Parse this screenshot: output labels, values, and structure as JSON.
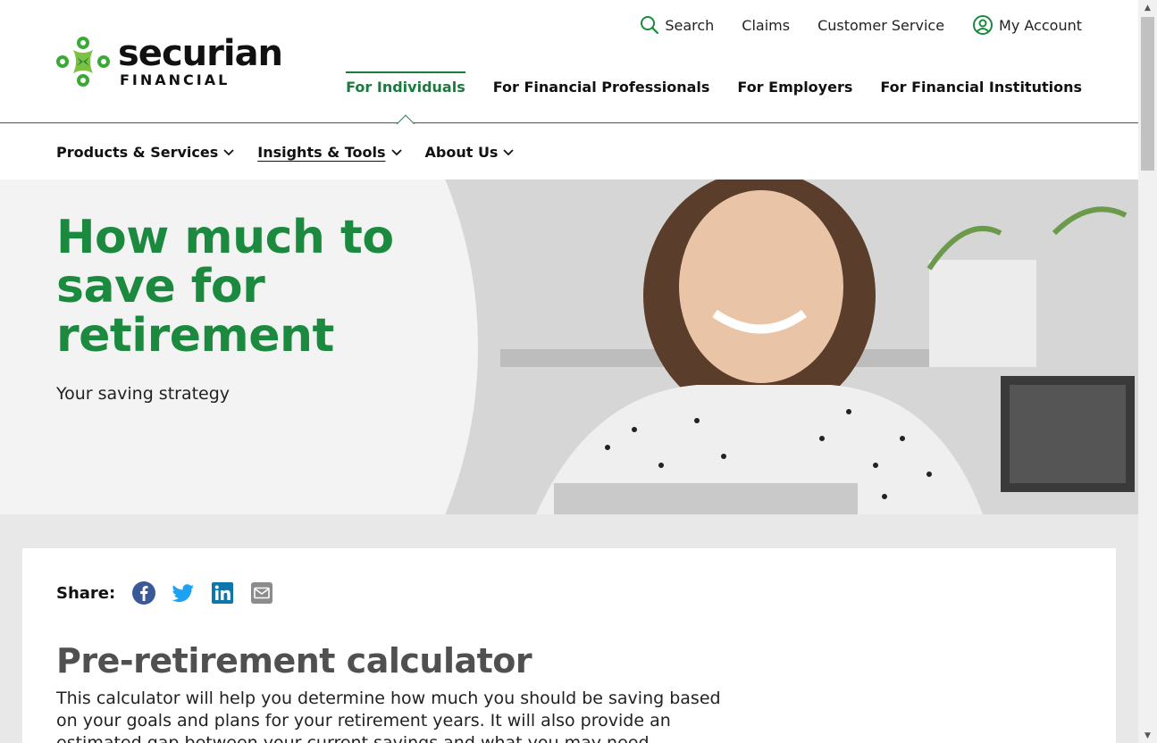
{
  "brand": {
    "name": "securian",
    "sub": "FINANCIAL",
    "green": "#1b8a3f"
  },
  "utility_nav": {
    "search": "Search",
    "claims": "Claims",
    "customer_service": "Customer Service",
    "my_account": "My Account"
  },
  "audience_nav": [
    {
      "label": "For Individuals",
      "active": true
    },
    {
      "label": "For Financial Professionals",
      "active": false
    },
    {
      "label": "For Employers",
      "active": false
    },
    {
      "label": "For Financial Institutions",
      "active": false
    }
  ],
  "sub_nav": [
    {
      "label": "Products & Services"
    },
    {
      "label": "Insights & Tools",
      "current": true
    },
    {
      "label": "About Us"
    }
  ],
  "hero": {
    "title": "How much to save for retirement",
    "subtitle": "Your saving strategy"
  },
  "share": {
    "label": "Share:",
    "icons": [
      "facebook-icon",
      "twitter-icon",
      "linkedin-icon",
      "email-icon"
    ]
  },
  "content": {
    "title": "Pre-retirement calculator",
    "description": "This calculator will help you determine how much you should be saving based on your goals and plans for your retirement years. It will also provide an estimated gap between your current savings and what you may need."
  }
}
